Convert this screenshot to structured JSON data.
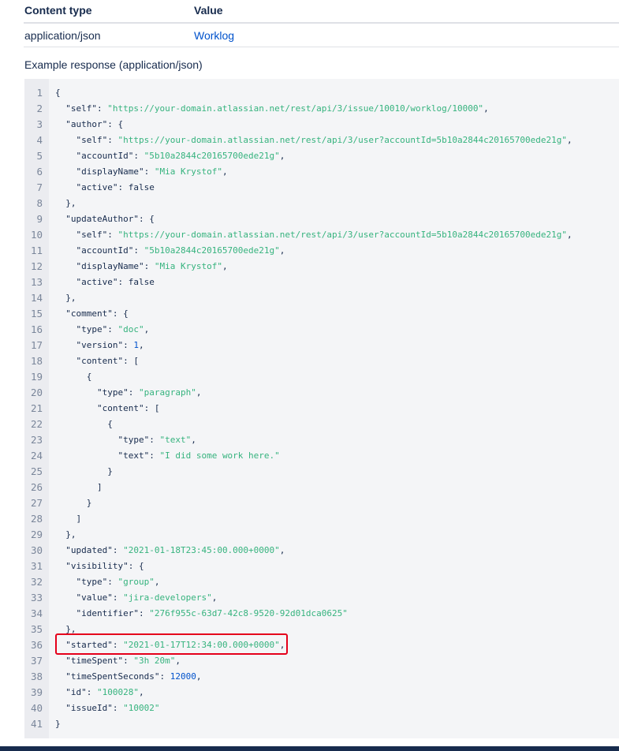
{
  "response_table": {
    "headers": {
      "content_type": "Content type",
      "value": "Value"
    },
    "rows": [
      {
        "content_type": "application/json",
        "value": "Worklog"
      }
    ]
  },
  "example_caption": "Example response (application/json)",
  "code": {
    "lines": [
      [
        [
          "p",
          "{"
        ]
      ],
      [
        [
          "k",
          "  \"self\""
        ],
        [
          "p",
          ": "
        ],
        [
          "s",
          "\"https://your-domain.atlassian.net/rest/api/3/issue/10010/worklog/10000\""
        ],
        [
          "p",
          ","
        ]
      ],
      [
        [
          "k",
          "  \"author\""
        ],
        [
          "p",
          ": {"
        ]
      ],
      [
        [
          "k",
          "    \"self\""
        ],
        [
          "p",
          ": "
        ],
        [
          "s",
          "\"https://your-domain.atlassian.net/rest/api/3/user?accountId=5b10a2844c20165700ede21g\""
        ],
        [
          "p",
          ","
        ]
      ],
      [
        [
          "k",
          "    \"accountId\""
        ],
        [
          "p",
          ": "
        ],
        [
          "s",
          "\"5b10a2844c20165700ede21g\""
        ],
        [
          "p",
          ","
        ]
      ],
      [
        [
          "k",
          "    \"displayName\""
        ],
        [
          "p",
          ": "
        ],
        [
          "s",
          "\"Mia Krystof\""
        ],
        [
          "p",
          ","
        ]
      ],
      [
        [
          "k",
          "    \"active\""
        ],
        [
          "p",
          ": "
        ],
        [
          "w",
          "false"
        ]
      ],
      [
        [
          "p",
          "  },"
        ]
      ],
      [
        [
          "k",
          "  \"updateAuthor\""
        ],
        [
          "p",
          ": {"
        ]
      ],
      [
        [
          "k",
          "    \"self\""
        ],
        [
          "p",
          ": "
        ],
        [
          "s",
          "\"https://your-domain.atlassian.net/rest/api/3/user?accountId=5b10a2844c20165700ede21g\""
        ],
        [
          "p",
          ","
        ]
      ],
      [
        [
          "k",
          "    \"accountId\""
        ],
        [
          "p",
          ": "
        ],
        [
          "s",
          "\"5b10a2844c20165700ede21g\""
        ],
        [
          "p",
          ","
        ]
      ],
      [
        [
          "k",
          "    \"displayName\""
        ],
        [
          "p",
          ": "
        ],
        [
          "s",
          "\"Mia Krystof\""
        ],
        [
          "p",
          ","
        ]
      ],
      [
        [
          "k",
          "    \"active\""
        ],
        [
          "p",
          ": "
        ],
        [
          "w",
          "false"
        ]
      ],
      [
        [
          "p",
          "  },"
        ]
      ],
      [
        [
          "k",
          "  \"comment\""
        ],
        [
          "p",
          ": {"
        ]
      ],
      [
        [
          "k",
          "    \"type\""
        ],
        [
          "p",
          ": "
        ],
        [
          "s",
          "\"doc\""
        ],
        [
          "p",
          ","
        ]
      ],
      [
        [
          "k",
          "    \"version\""
        ],
        [
          "p",
          ": "
        ],
        [
          "n",
          "1"
        ],
        [
          "p",
          ","
        ]
      ],
      [
        [
          "k",
          "    \"content\""
        ],
        [
          "p",
          ": ["
        ]
      ],
      [
        [
          "p",
          "      {"
        ]
      ],
      [
        [
          "k",
          "        \"type\""
        ],
        [
          "p",
          ": "
        ],
        [
          "s",
          "\"paragraph\""
        ],
        [
          "p",
          ","
        ]
      ],
      [
        [
          "k",
          "        \"content\""
        ],
        [
          "p",
          ": ["
        ]
      ],
      [
        [
          "p",
          "          {"
        ]
      ],
      [
        [
          "k",
          "            \"type\""
        ],
        [
          "p",
          ": "
        ],
        [
          "s",
          "\"text\""
        ],
        [
          "p",
          ","
        ]
      ],
      [
        [
          "k",
          "            \"text\""
        ],
        [
          "p",
          ": "
        ],
        [
          "s",
          "\"I did some work here.\""
        ]
      ],
      [
        [
          "p",
          "          }"
        ]
      ],
      [
        [
          "p",
          "        ]"
        ]
      ],
      [
        [
          "p",
          "      }"
        ]
      ],
      [
        [
          "p",
          "    ]"
        ]
      ],
      [
        [
          "p",
          "  },"
        ]
      ],
      [
        [
          "k",
          "  \"updated\""
        ],
        [
          "p",
          ": "
        ],
        [
          "s",
          "\"2021-01-18T23:45:00.000+0000\""
        ],
        [
          "p",
          ","
        ]
      ],
      [
        [
          "k",
          "  \"visibility\""
        ],
        [
          "p",
          ": {"
        ]
      ],
      [
        [
          "k",
          "    \"type\""
        ],
        [
          "p",
          ": "
        ],
        [
          "s",
          "\"group\""
        ],
        [
          "p",
          ","
        ]
      ],
      [
        [
          "k",
          "    \"value\""
        ],
        [
          "p",
          ": "
        ],
        [
          "s",
          "\"jira-developers\""
        ],
        [
          "p",
          ","
        ]
      ],
      [
        [
          "k",
          "    \"identifier\""
        ],
        [
          "p",
          ": "
        ],
        [
          "s",
          "\"276f955c-63d7-42c8-9520-92d01dca0625\""
        ]
      ],
      [
        [
          "p",
          "  },"
        ]
      ],
      [
        [
          "k",
          "  \"started\""
        ],
        [
          "p",
          ": "
        ],
        [
          "s",
          "\"2021-01-17T12:34:00.000+0000\""
        ],
        [
          "p",
          ","
        ]
      ],
      [
        [
          "k",
          "  \"timeSpent\""
        ],
        [
          "p",
          ": "
        ],
        [
          "s",
          "\"3h 20m\""
        ],
        [
          "p",
          ","
        ]
      ],
      [
        [
          "k",
          "  \"timeSpentSeconds\""
        ],
        [
          "p",
          ": "
        ],
        [
          "n",
          "12000"
        ],
        [
          "p",
          ","
        ]
      ],
      [
        [
          "k",
          "  \"id\""
        ],
        [
          "p",
          ": "
        ],
        [
          "s",
          "\"100028\""
        ],
        [
          "p",
          ","
        ]
      ],
      [
        [
          "k",
          "  \"issueId\""
        ],
        [
          "p",
          ": "
        ],
        [
          "s",
          "\"10002\""
        ]
      ],
      [
        [
          "p",
          "}"
        ]
      ]
    ]
  },
  "colors": {
    "string": "#36b37e",
    "number": "#0052cc",
    "key": "#172b4d",
    "highlight": "#e5001b",
    "code_bg": "#f4f5f7"
  }
}
